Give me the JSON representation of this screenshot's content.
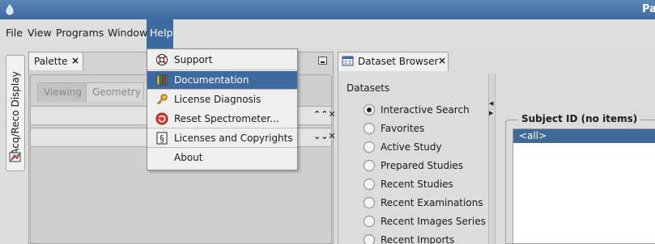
{
  "window": {
    "title": "Pa"
  },
  "menubar": {
    "items": [
      "File",
      "View",
      "Programs",
      "Window",
      "Help"
    ]
  },
  "left_vertical_tab": {
    "label": "Acq/Reco Display"
  },
  "palette": {
    "tab_label": "Palette",
    "close_glyph": "×",
    "subtabs": [
      "Viewing",
      "Geometry"
    ],
    "group_bars": [
      {
        "controls": "⌃⌃✕"
      },
      {
        "controls": "⌄⌄✕"
      }
    ]
  },
  "help_menu": {
    "items": [
      {
        "label": "Support",
        "icon": "lifebuoy-icon"
      },
      {
        "label": "Documentation",
        "icon": "books-icon",
        "highlighted": true
      },
      {
        "label": "License Diagnosis",
        "icon": "key-icon"
      },
      {
        "label": "Reset Spectrometer...",
        "icon": "reset-icon"
      },
      {
        "label": "Licenses and Copyrights",
        "icon": "section-sign-icon"
      },
      {
        "label": "About",
        "icon": ""
      }
    ]
  },
  "dataset_browser": {
    "tab_label": "Dataset Browser",
    "close_glyph": "×",
    "datasets_header": "Datasets",
    "datasets": [
      {
        "label": "Interactive Search",
        "selected": true
      },
      {
        "label": "Favorites",
        "selected": false
      },
      {
        "label": "Active Study",
        "selected": false
      },
      {
        "label": "Prepared Studies",
        "selected": false
      },
      {
        "label": "Recent Studies",
        "selected": false
      },
      {
        "label": "Recent Examinations",
        "selected": false
      },
      {
        "label": "Recent Images Series",
        "selected": false
      },
      {
        "label": "Recent Imports",
        "selected": false
      }
    ],
    "subject_id": {
      "title": "Subject ID (no items)",
      "items": [
        "<all>"
      ]
    }
  },
  "colors": {
    "titlebar": "#4a77aa",
    "selection": "#3d6a9f",
    "list_selection": "#3e6a99"
  }
}
